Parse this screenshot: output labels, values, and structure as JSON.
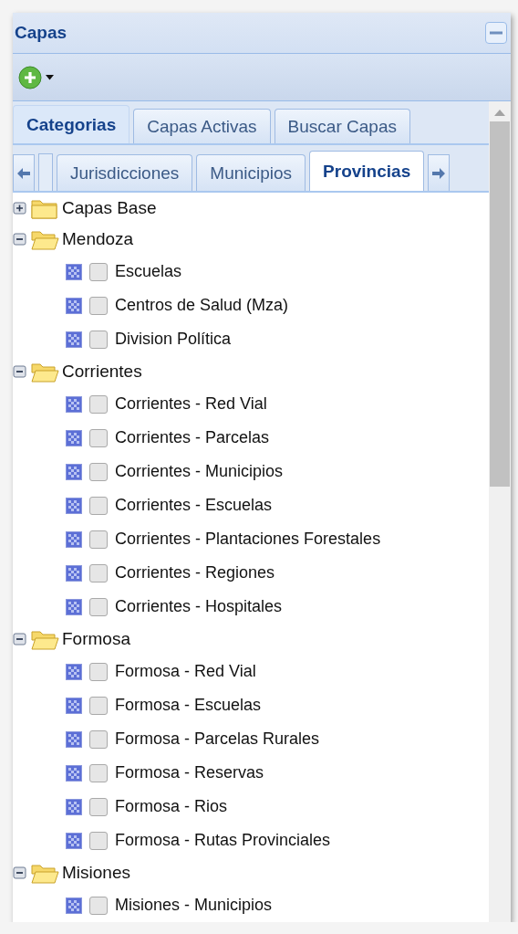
{
  "panel": {
    "title": "Capas"
  },
  "tabs": [
    {
      "label": "Categorias",
      "selected": true
    },
    {
      "label": "Capas Activas",
      "selected": false
    },
    {
      "label": "Buscar Capas",
      "selected": false
    }
  ],
  "subtabs": [
    {
      "label": "Jurisdicciones",
      "selected": false
    },
    {
      "label": "Municipios",
      "selected": false
    },
    {
      "label": "Provincias",
      "selected": true
    }
  ],
  "tree": [
    {
      "label": "Capas Base",
      "expanded": false
    },
    {
      "label": "Mendoza",
      "expanded": true,
      "children": [
        {
          "label": "Escuelas",
          "checked": false
        },
        {
          "label": "Centros de Salud (Mza)",
          "checked": false
        },
        {
          "label": "Division Política",
          "checked": false
        }
      ]
    },
    {
      "label": "Corrientes",
      "expanded": true,
      "children": [
        {
          "label": "Corrientes - Red Vial",
          "checked": false
        },
        {
          "label": "Corrientes - Parcelas",
          "checked": false
        },
        {
          "label": "Corrientes - Municipios",
          "checked": false
        },
        {
          "label": "Corrientes - Escuelas",
          "checked": false
        },
        {
          "label": "Corrientes - Plantaciones Forestales",
          "checked": false
        },
        {
          "label": "Corrientes - Regiones",
          "checked": false
        },
        {
          "label": "Corrientes - Hospitales",
          "checked": false
        }
      ]
    },
    {
      "label": "Formosa",
      "expanded": true,
      "children": [
        {
          "label": "Formosa - Red Vial",
          "checked": false
        },
        {
          "label": "Formosa - Escuelas",
          "checked": false
        },
        {
          "label": "Formosa - Parcelas Rurales",
          "checked": false
        },
        {
          "label": "Formosa - Reservas",
          "checked": false
        },
        {
          "label": "Formosa - Rios",
          "checked": false
        },
        {
          "label": "Formosa - Rutas Provinciales",
          "checked": false
        }
      ]
    },
    {
      "label": "Misiones",
      "expanded": true,
      "children": [
        {
          "label": "Misiones - Municipios",
          "checked": false
        }
      ]
    }
  ]
}
